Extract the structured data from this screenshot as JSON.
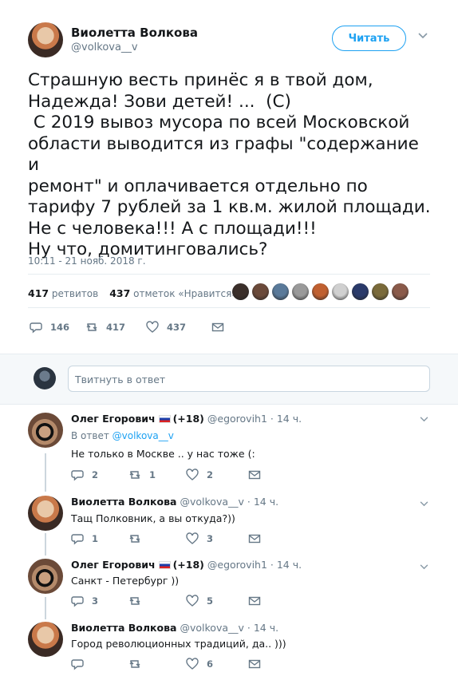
{
  "tweet": {
    "author_name": "Виолетта Волкова",
    "author_handle": "@volkova__v",
    "follow_label": "Читать",
    "text": "Страшную весть принёс я в твой дом,\nНадежда! Зови детей! ...  (С)\n С 2019 вывоз мусора по всей Московской\nобласти выводится из графы \"содержание и\nремонт\" и оплачивается отдельно по\nтарифу 7 рублей за 1 кв.м. жилой площади.\nНе с человека!!! А с площади!!!\nНу что, домитинговались?",
    "timestamp": "10:11 - 21 нояб. 2018 г.",
    "retweets_count": "417",
    "retweets_label": "ретвитов",
    "likes_count": "437",
    "likes_label": "отметок «Нравится»",
    "actions": {
      "replies": "146",
      "retweets": "417",
      "likes": "437"
    },
    "liker_colors": [
      "#3b2f2a",
      "#6b4a3a",
      "#5a7a9a",
      "#9a9a9a",
      "#c06030",
      "#d0d0d0",
      "#2a3a6a",
      "#7a6a3a",
      "#8a5a4a"
    ]
  },
  "reply_box": {
    "placeholder": "Твитнуть в ответ"
  },
  "replies": [
    {
      "name": "Олег Егорович",
      "badge": "(+18)",
      "handle": "@egorovih1",
      "time": "· 14 ч.",
      "reply_to_prefix": "В ответ",
      "reply_to_handle": "@volkova__v",
      "text": "Не только в Москве .. у нас тоже (:",
      "replies": "2",
      "retweets": "1",
      "likes": "2"
    },
    {
      "name": "Виолетта Волкова",
      "handle": "@volkova__v",
      "time": "· 14 ч.",
      "text": "Тащ Полковник, а вы откуда?))",
      "replies": "1",
      "retweets": "",
      "likes": "3"
    },
    {
      "name": "Олег Егорович",
      "badge": "(+18)",
      "handle": "@egorovih1",
      "time": "· 14 ч.",
      "text": "Санкт - Петербург ))",
      "replies": "3",
      "retweets": "",
      "likes": "5"
    },
    {
      "name": "Виолетта Волкова",
      "handle": "@volkova__v",
      "time": "· 14 ч.",
      "text": "Город революционных традиций, да.. )))",
      "replies": "",
      "retweets": "",
      "likes": "6"
    }
  ]
}
